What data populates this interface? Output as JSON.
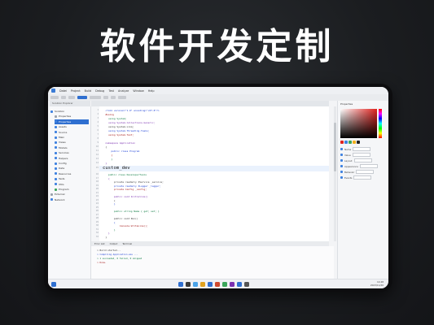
{
  "headline": "软件开发定制",
  "ide": {
    "menu": [
      "Datei",
      "Project",
      "Build",
      "Debug",
      "Test",
      "Analyze",
      "Window",
      "Help"
    ],
    "explorer_header": "Solution Explorer",
    "tree": [
      {
        "label": "Solution",
        "level": 1,
        "icon": "blue",
        "selected": false
      },
      {
        "label": "Properties",
        "level": 2,
        "icon": "gray",
        "selected": false
      },
      {
        "label": "Properties",
        "level": 2,
        "icon": "blue",
        "selected": true
      },
      {
        "label": "Assets",
        "level": 2,
        "icon": "blue",
        "selected": false
      },
      {
        "label": "Source",
        "level": 2,
        "icon": "blue",
        "selected": false
      },
      {
        "label": "Main",
        "level": 2,
        "icon": "blue",
        "selected": false
      },
      {
        "label": "Views",
        "level": 2,
        "icon": "blue",
        "selected": false
      },
      {
        "label": "Models",
        "level": 2,
        "icon": "blue",
        "selected": false
      },
      {
        "label": "Services",
        "level": 2,
        "icon": "blue",
        "selected": false
      },
      {
        "label": "Helpers",
        "level": 2,
        "icon": "blue",
        "selected": false
      },
      {
        "label": "Config",
        "level": 2,
        "icon": "blue",
        "selected": false
      },
      {
        "label": "Data",
        "level": 2,
        "icon": "blue",
        "selected": false
      },
      {
        "label": "Resources",
        "level": 2,
        "icon": "blue",
        "selected": false
      },
      {
        "label": "Tests",
        "level": 2,
        "icon": "blue",
        "selected": false
      },
      {
        "label": "Utils",
        "level": 2,
        "icon": "blue",
        "selected": false
      },
      {
        "label": "Program",
        "level": 2,
        "icon": "green",
        "selected": false
      },
      {
        "label": "External",
        "level": 1,
        "icon": "gray",
        "selected": false
      },
      {
        "label": "Network",
        "level": 1,
        "icon": "blue",
        "selected": false
      }
    ],
    "code_lines": [
      "  <?xml version=\"1.0\" encoding=\"utf-8\"?>",
      "  #using",
      "    using System;",
      "    using System.Collections.Generic;",
      "    using System.Linq;",
      "    using System.Threading.Tasks;",
      "    using System.Text;",
      "  ",
      "  namespace Application",
      "  {",
      "      public class Program",
      "      {",
      "      }",
      "  }"
    ],
    "highlight_text": "custom_dev",
    "code_lines_b": [
      "    public class DeveloperTools",
      "    {",
      "        private readonly IService _service;",
      "        private readonly ILogger _logger;",
      "        private Config _config;",
      "  ",
      "        public void Initialize()",
      "        {",
      "        }",
      "  ",
      "        public string Name { get; set; }",
      "  ",
      "        public void Run()",
      "        {",
      "            Console.WriteLine();",
      "        }",
      "    }",
      "  }"
    ],
    "output_tabs": [
      "Error List",
      "Output",
      "Terminal"
    ],
    "output_lines": [
      "  > Build started...",
      "  > Compiling Application.exe ...",
      "  > 1 succeeded, 0 failed, 0 skipped",
      "  > Done."
    ],
    "right_panel": {
      "title": "Properties",
      "rows": [
        "Name",
        "Value",
        "Layout",
        "Appearance",
        "Behavior",
        "Events"
      ]
    },
    "tray": {
      "time": "14:28",
      "date": "2023/11/20"
    }
  }
}
